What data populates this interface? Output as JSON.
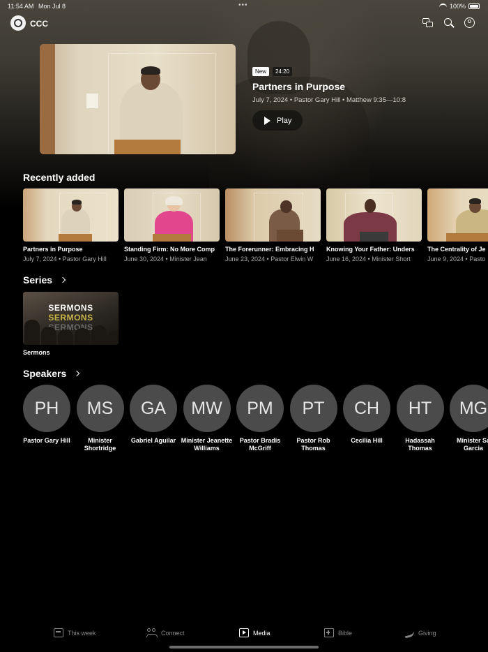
{
  "status_bar": {
    "time": "11:54 AM",
    "date": "Mon Jul 8",
    "battery": "100%"
  },
  "header": {
    "app_name": "CCC"
  },
  "featured": {
    "badge": "New",
    "duration": "24:20",
    "title": "Partners in Purpose",
    "meta": "July 7, 2024 • Pastor Gary Hill • Matthew 9:35—10:8",
    "play_label": "Play"
  },
  "recently_added": {
    "heading": "Recently added",
    "items": [
      {
        "title": "Partners in Purpose",
        "meta": "July 7, 2024 • Pastor Gary Hill"
      },
      {
        "title": "Standing Firm: No More Comp",
        "meta": "June 30, 2024 • Minister Jean"
      },
      {
        "title": "The Forerunner: Embracing H",
        "meta": "June 23, 2024 • Pastor Elwin W"
      },
      {
        "title": "Knowing Your Father: Unders",
        "meta": "June 16, 2024 • Minister Short"
      },
      {
        "title": "The Centrality of Je",
        "meta": "June 9, 2024 • Pasto"
      }
    ]
  },
  "series": {
    "heading": "Series",
    "items": [
      {
        "label": "Sermons",
        "art_words": [
          "SERMONS",
          "SERMONS",
          "SERMONS"
        ]
      }
    ]
  },
  "speakers": {
    "heading": "Speakers",
    "items": [
      {
        "initials": "PH",
        "name": "Pastor Gary Hill"
      },
      {
        "initials": "MS",
        "name": "Minister Shortridge"
      },
      {
        "initials": "GA",
        "name": "Gabriel Aguilar"
      },
      {
        "initials": "MW",
        "name": "Minister Jeanette Williams"
      },
      {
        "initials": "PM",
        "name": "Pastor Bradis McGriff"
      },
      {
        "initials": "PT",
        "name": "Pastor Rob Thomas"
      },
      {
        "initials": "CH",
        "name": "Cecilia Hill"
      },
      {
        "initials": "HT",
        "name": "Hadassah Thomas"
      },
      {
        "initials": "MG",
        "name": "Minister Sa Garcia"
      }
    ]
  },
  "tab_bar": {
    "items": [
      {
        "label": "This week",
        "icon": "calendar-icon"
      },
      {
        "label": "Connect",
        "icon": "people-icon"
      },
      {
        "label": "Media",
        "icon": "media-icon",
        "active": true
      },
      {
        "label": "Bible",
        "icon": "bible-icon"
      },
      {
        "label": "Giving",
        "icon": "giving-icon"
      }
    ]
  }
}
